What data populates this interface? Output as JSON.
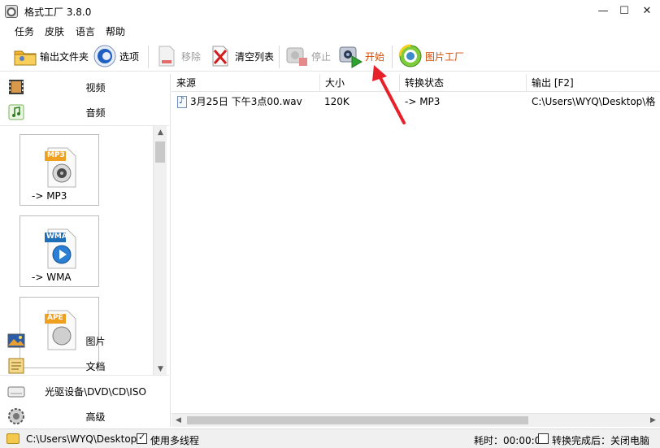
{
  "window": {
    "title": "格式工厂 3.8.0",
    "minimize_glyph": "—",
    "maximize_glyph": "☐",
    "close_glyph": "✕"
  },
  "menu": [
    "任务",
    "皮肤",
    "语言",
    "帮助"
  ],
  "toolbar": {
    "output_folder": "输出文件夹",
    "options": "选项",
    "remove": "移除",
    "clear_list": "清空列表",
    "stop": "停止",
    "start": "开始",
    "picture_factory": "图片工厂"
  },
  "sidebar": {
    "categories_top": [
      {
        "label": "视频",
        "icon": "film-icon"
      },
      {
        "label": "音频",
        "icon": "music-icon"
      }
    ],
    "tiles": [
      {
        "badge": "MP3",
        "label": "-> MP3"
      },
      {
        "badge": "WMA",
        "label": "-> WMA"
      },
      {
        "badge": "APE",
        "label": ""
      }
    ],
    "categories_bottom": [
      {
        "label": "图片",
        "icon": "picture-icon"
      },
      {
        "label": "文档",
        "icon": "document-icon"
      },
      {
        "label": "光驱设备\\DVD\\CD\\ISO",
        "icon": "disc-drive-icon"
      },
      {
        "label": "高级",
        "icon": "advanced-gear-icon"
      }
    ]
  },
  "table": {
    "columns": [
      "来源",
      "大小",
      "转换状态",
      "输出 [F2]"
    ],
    "rows": [
      {
        "source": "3月25日 下午3点00.wav",
        "size": "120K",
        "status": "-> MP3",
        "output": "C:\\Users\\WYQ\\Desktop\\格"
      }
    ]
  },
  "statusbar": {
    "path": "C:\\Users\\WYQ\\Desktop",
    "multithread_label": "使用多线程",
    "multithread_checked": true,
    "elapsed": "耗时：00:00:00",
    "shutdown_label": "转换完成后：关闭电脑",
    "shutdown_checked": false
  },
  "colors": {
    "accent_orange": "#d24a00",
    "annotation_red": "#e8202a",
    "start_green": "#2fa32f"
  }
}
